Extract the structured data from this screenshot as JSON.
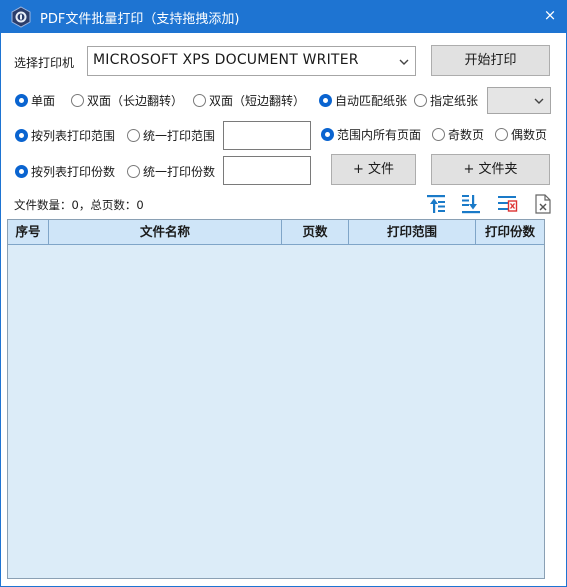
{
  "window": {
    "title": "PDF文件批量打印（支持拖拽添加)",
    "close_glyph": "×"
  },
  "printer": {
    "label": "选择打印机",
    "selected": "MICROSOFT XPS DOCUMENT WRITER",
    "start_button": "开始打印"
  },
  "duplex": {
    "options": [
      "单面",
      "双面（长边翻转）",
      "双面（短边翻转）"
    ],
    "selected_index": 0
  },
  "paper": {
    "options": [
      "自动匹配纸张",
      "指定纸张"
    ],
    "selected_index": 0,
    "size_value": ""
  },
  "range": {
    "options": [
      "按列表打印范围",
      "统一打印范围"
    ],
    "selected_index": 0,
    "value": ""
  },
  "pages": {
    "options": [
      "范围内所有页面",
      "奇数页",
      "偶数页"
    ],
    "selected_index": 0
  },
  "copies": {
    "options": [
      "按列表打印份数",
      "统一打印份数"
    ],
    "selected_index": 0,
    "value": ""
  },
  "add": {
    "file_button": "+ 文件",
    "folder_button": "+ 文件夹"
  },
  "status": {
    "text": "文件数量：0，总页数：0"
  },
  "toolbar": {
    "icons": [
      "move-to-top-icon",
      "move-to-bottom-icon",
      "clear-list-icon",
      "delete-file-icon"
    ]
  },
  "table": {
    "columns": [
      "序号",
      "文件名称",
      "页数",
      "打印范围",
      "打印份数"
    ],
    "rows": []
  },
  "colors": {
    "titlebar": "#1e74d2",
    "grid_bg": "#dcecf8",
    "header_bg": "#cfe5f8",
    "radio_on": "#0a64d0"
  }
}
